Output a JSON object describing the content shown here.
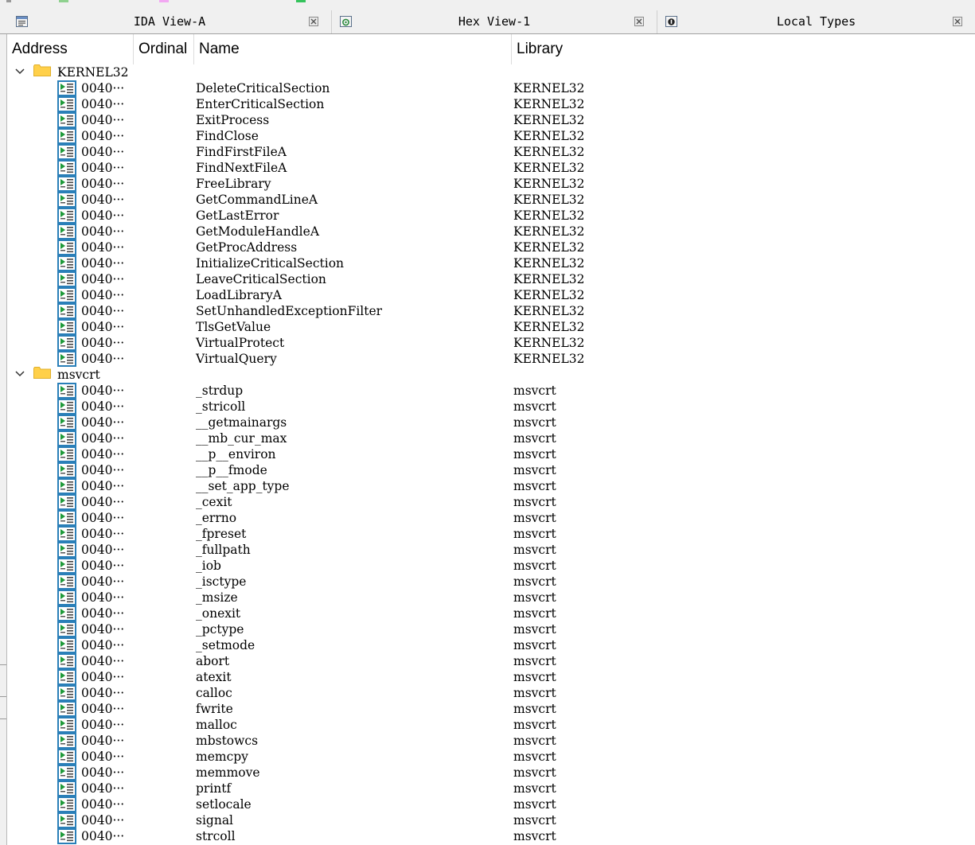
{
  "tabs": [
    {
      "title": "IDA View-A",
      "icon": "ida-view-icon"
    },
    {
      "title": "Hex View-1",
      "icon": "hex-view-icon"
    },
    {
      "title": "Local Types",
      "icon": "local-types-icon"
    }
  ],
  "columns": {
    "address": "Address",
    "ordinal": "Ordinal",
    "name": "Name",
    "library": "Library"
  },
  "groups": [
    {
      "name": "KERNEL32",
      "expanded": true,
      "imports": [
        {
          "address": "0040···",
          "name": "DeleteCriticalSection",
          "library": "KERNEL32"
        },
        {
          "address": "0040···",
          "name": "EnterCriticalSection",
          "library": "KERNEL32"
        },
        {
          "address": "0040···",
          "name": "ExitProcess",
          "library": "KERNEL32"
        },
        {
          "address": "0040···",
          "name": "FindClose",
          "library": "KERNEL32"
        },
        {
          "address": "0040···",
          "name": "FindFirstFileA",
          "library": "KERNEL32"
        },
        {
          "address": "0040···",
          "name": "FindNextFileA",
          "library": "KERNEL32"
        },
        {
          "address": "0040···",
          "name": "FreeLibrary",
          "library": "KERNEL32"
        },
        {
          "address": "0040···",
          "name": "GetCommandLineA",
          "library": "KERNEL32"
        },
        {
          "address": "0040···",
          "name": "GetLastError",
          "library": "KERNEL32"
        },
        {
          "address": "0040···",
          "name": "GetModuleHandleA",
          "library": "KERNEL32"
        },
        {
          "address": "0040···",
          "name": "GetProcAddress",
          "library": "KERNEL32"
        },
        {
          "address": "0040···",
          "name": "InitializeCriticalSection",
          "library": "KERNEL32"
        },
        {
          "address": "0040···",
          "name": "LeaveCriticalSection",
          "library": "KERNEL32"
        },
        {
          "address": "0040···",
          "name": "LoadLibraryA",
          "library": "KERNEL32"
        },
        {
          "address": "0040···",
          "name": "SetUnhandledExceptionFilter",
          "library": "KERNEL32"
        },
        {
          "address": "0040···",
          "name": "TlsGetValue",
          "library": "KERNEL32"
        },
        {
          "address": "0040···",
          "name": "VirtualProtect",
          "library": "KERNEL32"
        },
        {
          "address": "0040···",
          "name": "VirtualQuery",
          "library": "KERNEL32"
        }
      ]
    },
    {
      "name": "msvcrt",
      "expanded": true,
      "imports": [
        {
          "address": "0040···",
          "name": "_strdup",
          "library": "msvcrt"
        },
        {
          "address": "0040···",
          "name": "_stricoll",
          "library": "msvcrt"
        },
        {
          "address": "0040···",
          "name": "__getmainargs",
          "library": "msvcrt"
        },
        {
          "address": "0040···",
          "name": "__mb_cur_max",
          "library": "msvcrt"
        },
        {
          "address": "0040···",
          "name": "__p__environ",
          "library": "msvcrt"
        },
        {
          "address": "0040···",
          "name": "__p__fmode",
          "library": "msvcrt"
        },
        {
          "address": "0040···",
          "name": "__set_app_type",
          "library": "msvcrt"
        },
        {
          "address": "0040···",
          "name": "_cexit",
          "library": "msvcrt"
        },
        {
          "address": "0040···",
          "name": "_errno",
          "library": "msvcrt"
        },
        {
          "address": "0040···",
          "name": "_fpreset",
          "library": "msvcrt"
        },
        {
          "address": "0040···",
          "name": "_fullpath",
          "library": "msvcrt"
        },
        {
          "address": "0040···",
          "name": "_iob",
          "library": "msvcrt"
        },
        {
          "address": "0040···",
          "name": "_isctype",
          "library": "msvcrt"
        },
        {
          "address": "0040···",
          "name": "_msize",
          "library": "msvcrt"
        },
        {
          "address": "0040···",
          "name": "_onexit",
          "library": "msvcrt"
        },
        {
          "address": "0040···",
          "name": "_pctype",
          "library": "msvcrt"
        },
        {
          "address": "0040···",
          "name": "_setmode",
          "library": "msvcrt"
        },
        {
          "address": "0040···",
          "name": "abort",
          "library": "msvcrt"
        },
        {
          "address": "0040···",
          "name": "atexit",
          "library": "msvcrt"
        },
        {
          "address": "0040···",
          "name": "calloc",
          "library": "msvcrt"
        },
        {
          "address": "0040···",
          "name": "fwrite",
          "library": "msvcrt"
        },
        {
          "address": "0040···",
          "name": "malloc",
          "library": "msvcrt"
        },
        {
          "address": "0040···",
          "name": "mbstowcs",
          "library": "msvcrt"
        },
        {
          "address": "0040···",
          "name": "memcpy",
          "library": "msvcrt"
        },
        {
          "address": "0040···",
          "name": "memmove",
          "library": "msvcrt"
        },
        {
          "address": "0040···",
          "name": "printf",
          "library": "msvcrt"
        },
        {
          "address": "0040···",
          "name": "setlocale",
          "library": "msvcrt"
        },
        {
          "address": "0040···",
          "name": "signal",
          "library": "msvcrt"
        },
        {
          "address": "0040···",
          "name": "strcoll",
          "library": "msvcrt"
        }
      ]
    }
  ],
  "colors": {
    "folder": "#ffd04a",
    "import_icon_frame": "#2a7fb8",
    "import_icon_arrow": "#1f9a3a"
  }
}
